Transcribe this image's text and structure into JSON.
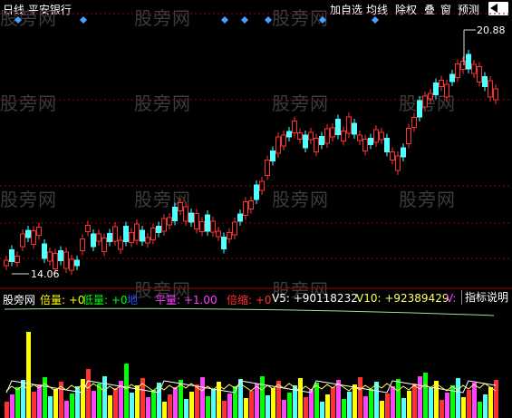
{
  "title": "日线 平安银行",
  "toolbar": {
    "add_watchlist": "加自选",
    "ma_line": "均线",
    "exright": "除权",
    "overlay": "叠",
    "window": "窗",
    "forecast": "预测"
  },
  "watermark": "股旁网",
  "price_labels": {
    "high": "20.88",
    "low": "14.06"
  },
  "indicator": {
    "name": "股旁网",
    "bei_liang": "倍量: +0",
    "di_liang": "低量: +0",
    "di_mark": "地",
    "ping_liang": "平量: +1.00",
    "bei_suo": "倍缩: +0",
    "v5": "V5: +90118232",
    "v10": "V10: +92389429",
    "v_tail": "V:",
    "explain_button": "指标说明"
  },
  "colors": {
    "up": "#ff3232",
    "down": "#54ffff",
    "grid": "#a00000",
    "diamond": "#4aa0ff",
    "bei_liang": "#ffff00",
    "di_liang": "#00ff00",
    "ping_liang": "#ff40ff",
    "bei_suo": "#ff3030"
  }
}
